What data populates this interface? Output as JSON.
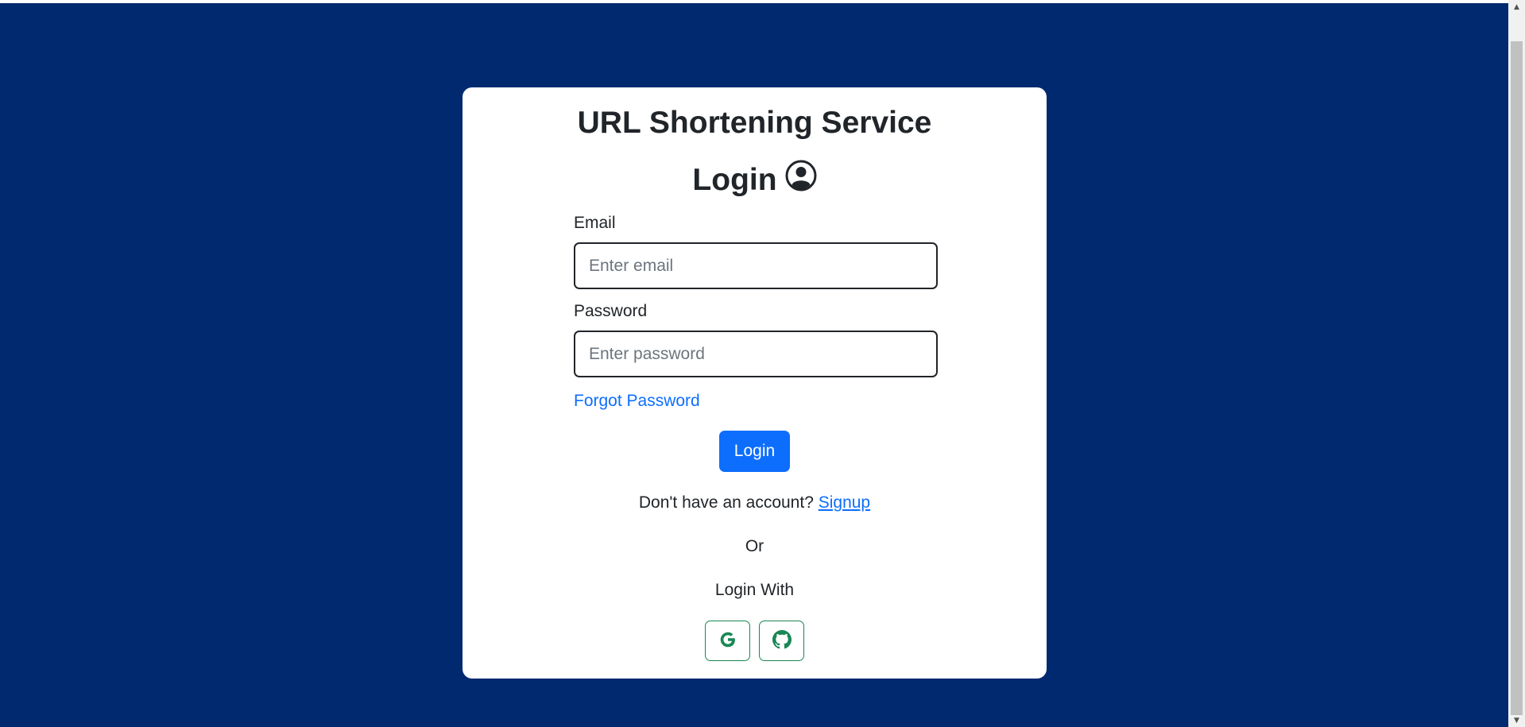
{
  "card": {
    "site_title": "URL Shortening Service",
    "login_heading": "Login"
  },
  "form": {
    "email_label": "Email",
    "email_placeholder": "Enter email",
    "password_label": "Password",
    "password_placeholder": "Enter password",
    "forgot_password": "Forgot Password",
    "login_button": "Login"
  },
  "footer": {
    "no_account_text": "Don't have an account?",
    "signup_link": "Signup",
    "or_text": "Or",
    "login_with": "Login With"
  },
  "icons": {
    "heading": "user-circle-icon",
    "google": "google-icon",
    "github": "github-icon"
  },
  "colors": {
    "page_background": "#00296f",
    "primary": "#0d6efd",
    "social_outline": "#198754",
    "text": "#212529"
  }
}
